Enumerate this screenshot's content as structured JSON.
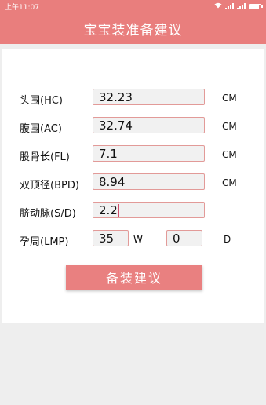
{
  "status_bar": {
    "time": "上午11:07",
    "battery_level": 0.85
  },
  "header": {
    "title": "宝宝装准备建议"
  },
  "form": {
    "rows": [
      {
        "label": "头围(HC)",
        "value": "32.23",
        "unit": "CM"
      },
      {
        "label": "腹围(AC)",
        "value": "32.74",
        "unit": "CM"
      },
      {
        "label": "股骨长(FL)",
        "value": "7.1",
        "unit": "CM"
      },
      {
        "label": "双顶径(BPD)",
        "value": "8.94",
        "unit": "CM"
      },
      {
        "label": "脐动脉(S/D)",
        "value": "2.2",
        "unit": ""
      }
    ],
    "lmp": {
      "label": "孕周(LMP)",
      "weeks_value": "35",
      "weeks_unit": "W",
      "days_value": "0",
      "days_unit": "D"
    },
    "submit_label": "备装建议"
  }
}
